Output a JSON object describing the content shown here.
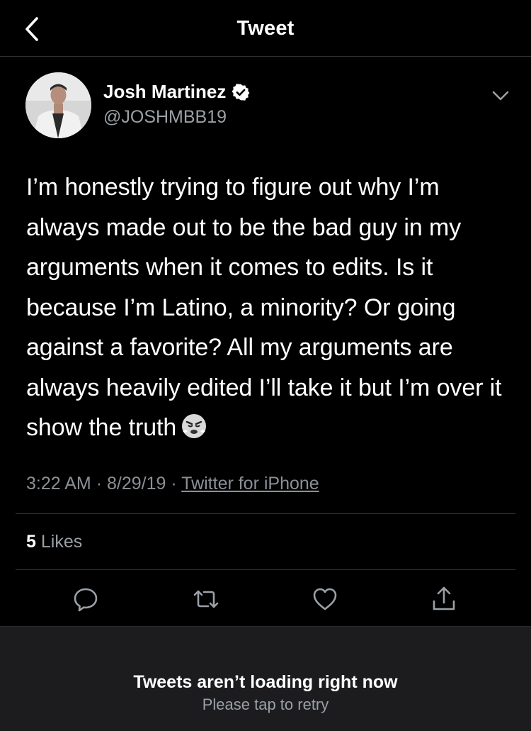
{
  "header": {
    "title": "Tweet"
  },
  "tweet": {
    "author_name": "Josh Martinez",
    "handle": "@JOSHMBB19",
    "verified": true,
    "text": "I’m honestly trying to figure out why I’m always made out to be the bad guy in my arguments when it comes to edits. Is it because I’m Latino, a minority? Or going against a favorite? All my arguments are always heavily edited I’ll take it but I’m over it show the truth",
    "emoji": "😤",
    "time": "3:22 AM",
    "date": "8/29/19",
    "separator": "·",
    "source": "Twitter for iPhone",
    "likes_count": "5",
    "likes_label": "Likes"
  },
  "icons": [
    "back-chevron-icon",
    "verified-badge-icon",
    "chevron-down-icon",
    "reply-icon",
    "retweet-icon",
    "like-icon",
    "share-icon"
  ],
  "footer": {
    "message": "Tweets aren’t loading right now",
    "action": "Please tap to retry"
  },
  "colors": {
    "background": "#000000",
    "secondary_text": "#9aa0a6",
    "divider": "#2f3336",
    "footer_bg": "#1c1c1e"
  }
}
